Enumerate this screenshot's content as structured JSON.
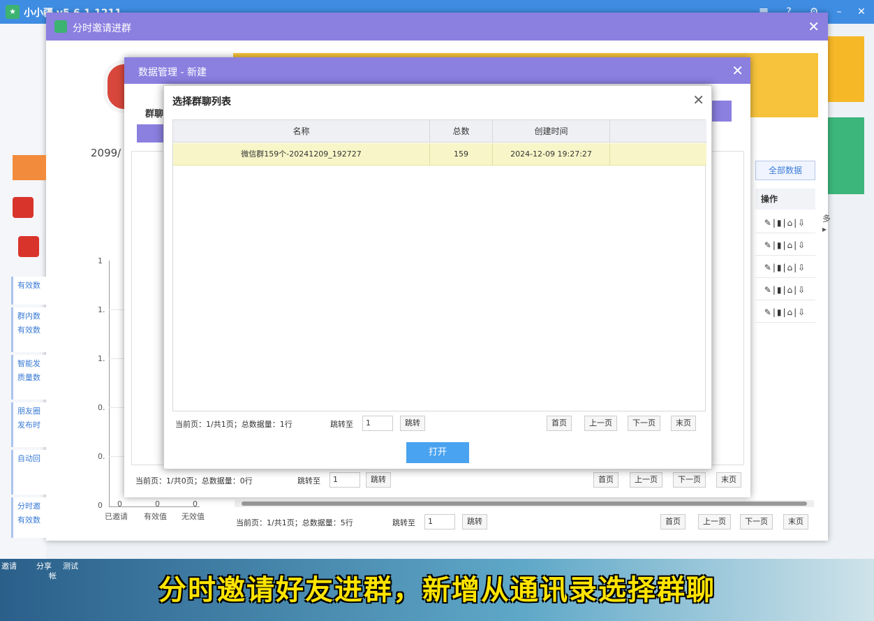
{
  "app": {
    "title": "小小疆 v5.6.1.1211"
  },
  "dialog1": {
    "title": "分时邀请进群",
    "date": "2099/",
    "chart": {
      "yticks": [
        "1",
        "1.",
        "1.",
        "0.",
        "0.",
        "0"
      ],
      "xlabels": [
        "已邀请",
        "有效值",
        "无效值"
      ],
      "values": [
        "0",
        "0",
        "0"
      ]
    },
    "all_data_label": "全部数据",
    "op_header": "操作",
    "op_rows": [
      "✎|▮|⌂|⇩",
      "✎|▮|⌂|⇩",
      "✎|▮|⌂|⇩",
      "✎|▮|⌂|⇩",
      "✎|▮|⌂|⇩"
    ],
    "more": "多▸",
    "pager": {
      "current": "当前页：1/共1页；总数据量：5行",
      "jump_label": "跳转至",
      "jump_value": "1",
      "jump_btn": "跳转",
      "first": "首页",
      "prev": "上一页",
      "next": "下一页",
      "last": "末页"
    },
    "left_labels": [
      "有效数",
      "群内数",
      "有效数",
      "智能发",
      "质量数",
      "朋友圈",
      "发布时",
      "自动回",
      "分时邀",
      "有效数"
    ]
  },
  "dialog2": {
    "title": "数据管理 - 新建",
    "label": "群聊",
    "pager": {
      "current": "当前页：1/共0页；总数据量：0行",
      "jump_label": "跳转至",
      "jump_value": "1",
      "jump_btn": "跳转",
      "first": "首页",
      "prev": "上一页",
      "next": "下一页",
      "last": "末页"
    }
  },
  "dialog3": {
    "title": "选择群聊列表",
    "columns": [
      "名称",
      "总数",
      "创建时间",
      ""
    ],
    "rows": [
      {
        "name": "微信群159个-20241209_192727",
        "total": "159",
        "created": "2024-12-09 19:27:27"
      }
    ],
    "pager": {
      "current": "当前页：1/共1页；总数据量：1行",
      "jump_label": "跳转至",
      "jump_value": "1",
      "jump_btn": "跳转",
      "first": "首页",
      "prev": "上一页",
      "next": "下一页",
      "last": "末页"
    },
    "open_label": "打开"
  },
  "subtitle": "分时邀请好友进群，新增从通讯录选择群聊",
  "taskbar": [
    "邀请",
    "分享",
    "测试",
    "帐"
  ],
  "colors": {
    "titlebar": "#8b7fe0",
    "selected_row": "#f8f6c8",
    "open_button": "#4aa3f0",
    "subtitle": "#ffe400"
  }
}
